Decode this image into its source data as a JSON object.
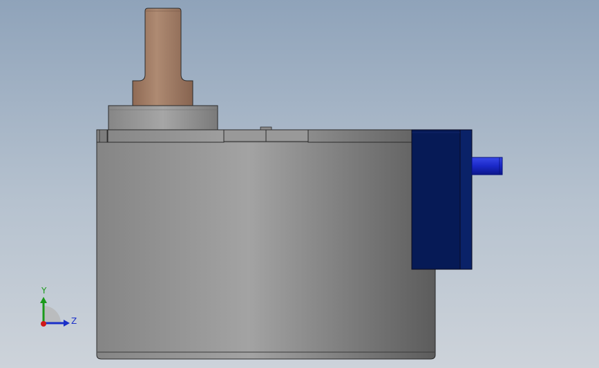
{
  "triad": {
    "y_label": "Y",
    "z_label": "Z"
  },
  "colors": {
    "background_top": "#8fa3ba",
    "background_bottom": "#cdd3da",
    "body_gray": "#8a8a8a",
    "shaft_brown": "#a07a62",
    "connector_navy": "#061a56",
    "pin_blue": "#1a28c8",
    "axis_y_green": "#1a9a1a",
    "axis_z_blue": "#1a2fc8",
    "axis_x_red": "#d01818"
  }
}
